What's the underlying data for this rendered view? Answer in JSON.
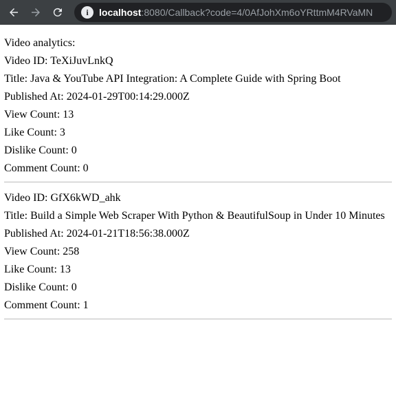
{
  "browser": {
    "url_host": "localhost",
    "url_rest": ":8080/Callback?code=4/0AfJohXm6oYRttmM4RVaMN"
  },
  "page": {
    "heading": "Video analytics:"
  },
  "labels": {
    "video_id": "Video ID: ",
    "title": "Title: ",
    "published_at": "Published At: ",
    "view_count": "View Count: ",
    "like_count": "Like Count: ",
    "dislike_count": "Dislike Count: ",
    "comment_count": "Comment Count: "
  },
  "videos": [
    {
      "id": "TeXiJuvLnkQ",
      "title": "Java & YouTube API Integration: A Complete Guide with Spring Boot",
      "published_at": "2024-01-29T00:14:29.000Z",
      "view_count": "13",
      "like_count": "3",
      "dislike_count": "0",
      "comment_count": "0"
    },
    {
      "id": "GfX6kWD_ahk",
      "title": "Build a Simple Web Scraper With Python & BeautifulSoup in Under 10 Minutes",
      "published_at": "2024-01-21T18:56:38.000Z",
      "view_count": "258",
      "like_count": "13",
      "dislike_count": "0",
      "comment_count": "1"
    }
  ]
}
